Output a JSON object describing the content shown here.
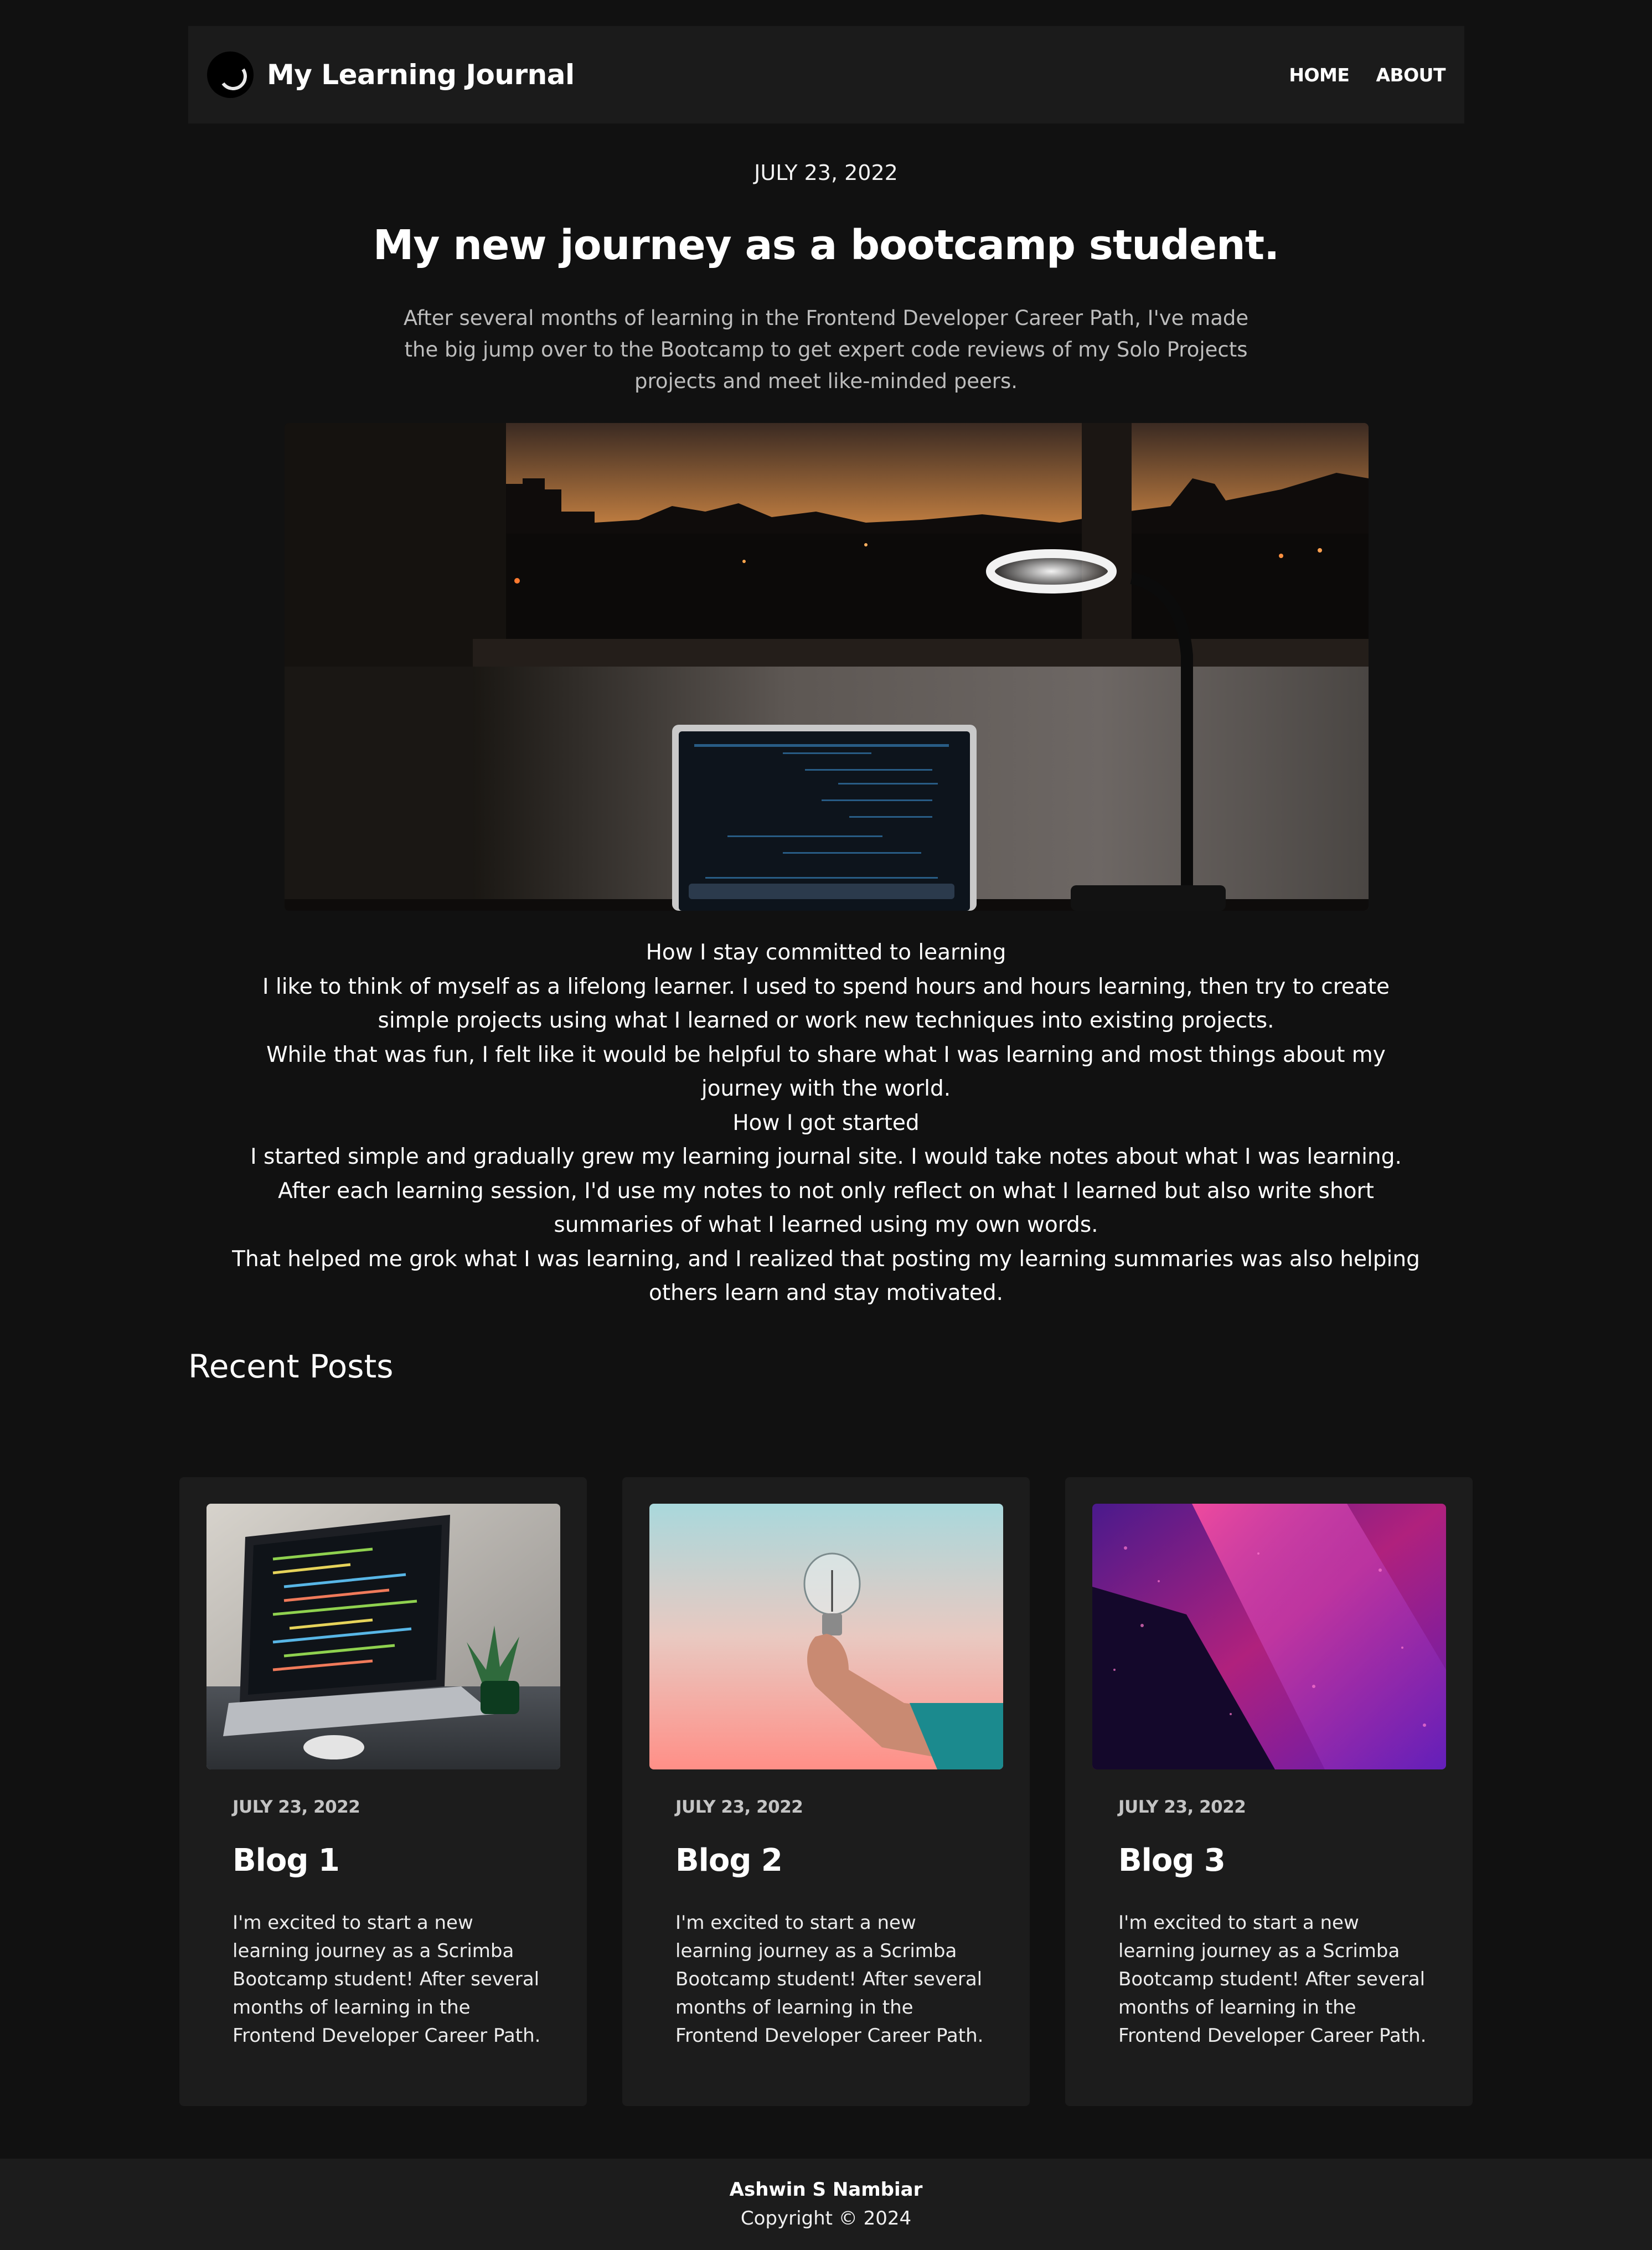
{
  "header": {
    "site_title": "My Learning Journal",
    "logo_icon": "journal-logo-icon",
    "nav": [
      {
        "label": "HOME"
      },
      {
        "label": "ABOUT"
      }
    ]
  },
  "hero": {
    "date": "JULY 23, 2022",
    "title": "My new journey as a bootcamp student.",
    "intro": "After several months of learning in the Frontend Developer Career Path, I've made the big jump over to the Bootcamp to get expert code reviews of my Solo Projects projects and meet like-minded peers."
  },
  "article": {
    "paragraphs": [
      "How I stay committed to learning",
      "I like to think of myself as a lifelong learner. I used to spend hours and hours learning, then try to create simple projects using what I learned or work new techniques into existing projects.",
      "While that was fun, I felt like it would be helpful to share what I was learning and most things about my journey with the world.",
      "How I got started",
      "I started simple and gradually grew my learning journal site. I would take notes about what I was learning. After each learning session, I'd use my notes to not only reflect on what I learned but also write short summaries of what I learned using my own words.",
      "That helped me grok what I was learning, and I realized that posting my learning summaries was also helping others learn and stay motivated."
    ]
  },
  "recent": {
    "title": "Recent Posts",
    "posts": [
      {
        "date": "JULY 23, 2022",
        "title": "Blog 1",
        "text": "I'm excited to start a new learning journey as a Scrimba Bootcamp student! After several months of learning in the Frontend Developer Career Path."
      },
      {
        "date": "JULY 23, 2022",
        "title": "Blog 2",
        "text": "I'm excited to start a new learning journey as a Scrimba Bootcamp student! After several months of learning in the Frontend Developer Career Path."
      },
      {
        "date": "JULY 23, 2022",
        "title": "Blog 3",
        "text": "I'm excited to start a new learning journey as a Scrimba Bootcamp student! After several months of learning in the Frontend Developer Career Path."
      }
    ]
  },
  "footer": {
    "name": "Ashwin S Nambiar",
    "copyright": "Copyright © 2024"
  },
  "colors": {
    "background": "#111111",
    "panel": "#1c1c1c",
    "text": "#ffffff",
    "muted_text": "#bdbdbd"
  }
}
